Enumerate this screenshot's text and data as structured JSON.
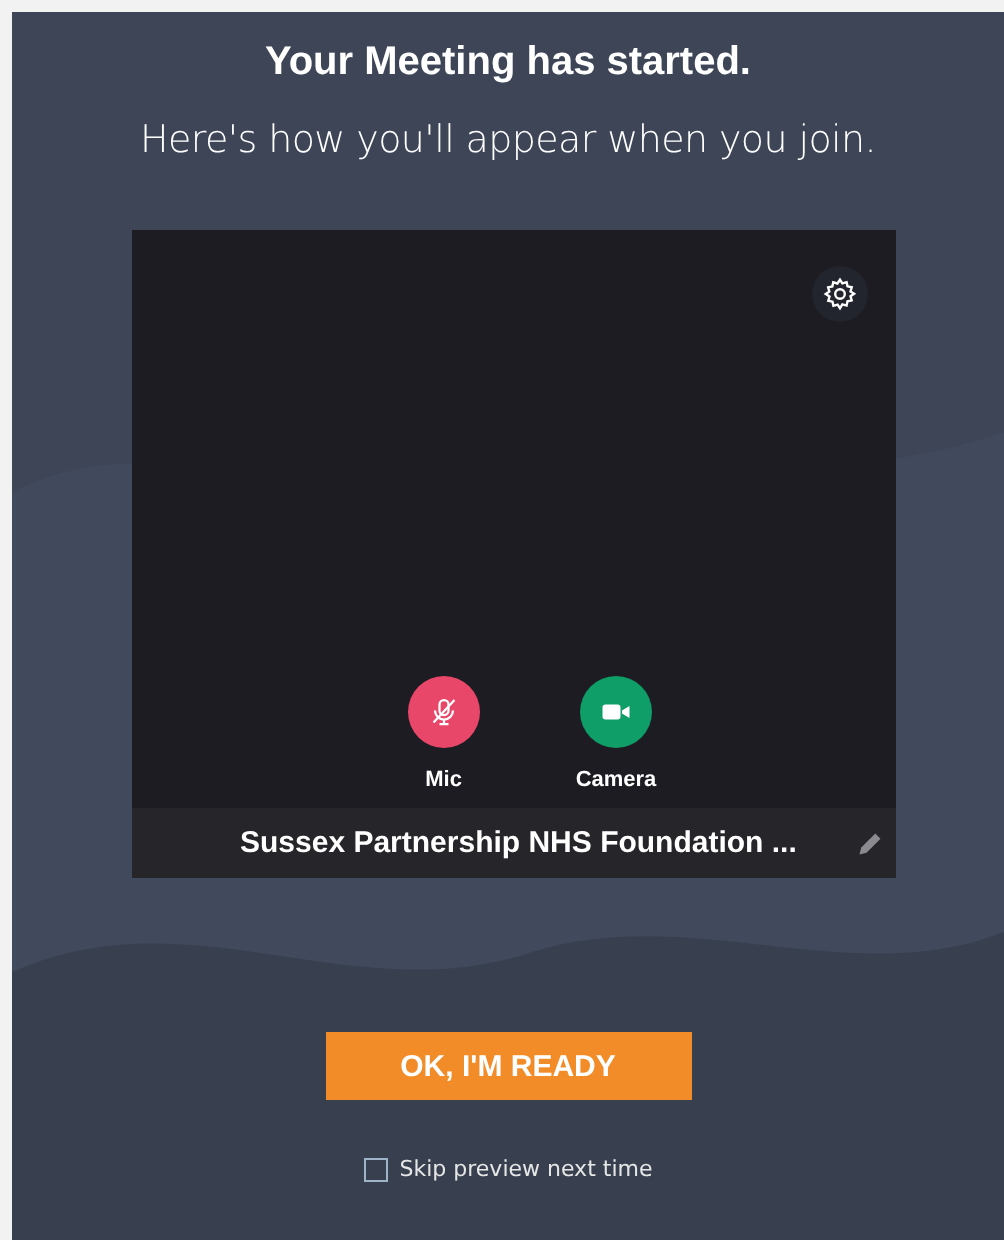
{
  "title": "Your Meeting has started.",
  "subtitle": "Here's how you'll appear when you join.",
  "preview": {
    "display_name": "Sussex Partnership NHS Foundation ...",
    "controls": [
      {
        "kind": "mic",
        "label": "Mic",
        "on": false
      },
      {
        "kind": "camera",
        "label": "Camera",
        "on": true
      }
    ]
  },
  "ready_button": "OK, I'M READY",
  "skip_preview": {
    "label": "Skip preview next time",
    "checked": false
  }
}
